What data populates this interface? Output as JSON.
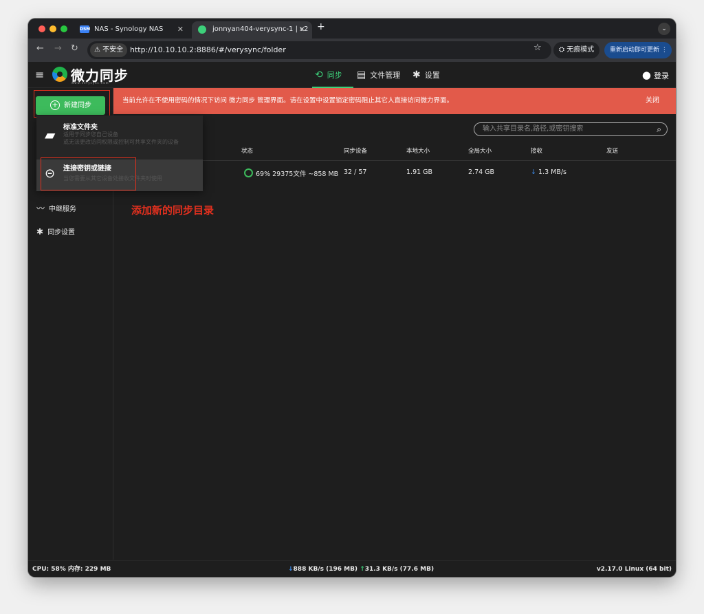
{
  "browser": {
    "tabs": [
      {
        "label": "NAS - Synology NAS",
        "favicon": "DSM"
      },
      {
        "label": "jonnyan404-verysync-1 | v2",
        "favicon": "verysync"
      }
    ],
    "new_tab": "+",
    "insecure_label": "不安全",
    "url": "http://10.10.10.2:8886/#/verysync/folder",
    "incognito_label": "无痕模式",
    "restart_label": "重新启动即可更新"
  },
  "header": {
    "logo_text": "微力同步",
    "logo_sub": "www.verysync.com",
    "nav": [
      {
        "label": "同步",
        "icon": "sync-icon"
      },
      {
        "label": "文件管理",
        "icon": "file-icon"
      },
      {
        "label": "设置",
        "icon": "gear-icon"
      }
    ],
    "login_label": "登录"
  },
  "banner": {
    "text": "当前允许在不使用密码的情况下访问 微力同步 管理界面。请在设置中设置锁定密码阻止其它人直接访问微力界面。",
    "close_label": "关闭"
  },
  "sidebar": {
    "new_sync_label": "新建同步",
    "items": [
      {
        "label": "中继服务",
        "icon": "relay-icon"
      },
      {
        "label": "同步设置",
        "icon": "gear-icon"
      }
    ]
  },
  "dropdown": {
    "items": [
      {
        "title": "标准文件夹",
        "desc1": "适用于同步您自己设备",
        "desc2": "或无法更改访问权限或控制可共享文件夹的设备"
      },
      {
        "title": "连接密钥或链接",
        "desc1": "当您需要从其它设备处接收文件夹时使用"
      }
    ]
  },
  "search": {
    "placeholder": "输入共享目录名,路径,或密钥搜索"
  },
  "table": {
    "headers": [
      "状态",
      "同步设备",
      "本地大小",
      "全局大小",
      "接收",
      "发送"
    ],
    "row": {
      "status": "69% 29375文件 ~858 MB",
      "devices": "32 / 57",
      "local": "1.91 GB",
      "global": "2.74 GB",
      "receive": "1.3 MB/s",
      "send": ""
    }
  },
  "annotation": "添加新的同步目录",
  "statusbar": {
    "left": "CPU: 58%  内存: 229 MB",
    "down": "888 KB/s (196 MB)",
    "up": "31.3 KB/s (77.6 MB)",
    "right": "v2.17.0  Linux (64 bit)"
  },
  "colors": {
    "accent": "#3dbb5c",
    "banner": "#e25a4a",
    "annotation": "#e0301e"
  }
}
